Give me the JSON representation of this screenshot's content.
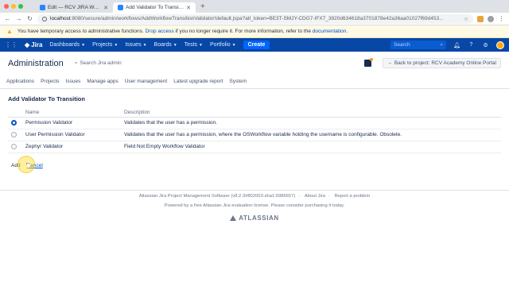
{
  "browser": {
    "tabs": [
      {
        "title": "Edit — RCV JIRA Workflow Tut",
        "active": false
      },
      {
        "title": "Add Validator To Transition - R",
        "active": true
      }
    ],
    "url_host": "localhost",
    "url_path": ":8080/secure/admin/workflows/AddWorkflowTransitionValidator!default.jspa?atl_token=BE3T-SMJY-CDG7-IFX7_3920d634618a3701878e42a36aa01027f69d453...",
    "new_tab_label": "+"
  },
  "banner": {
    "text_before": "You have temporary access to administrative functions.",
    "drop_link": "Drop access",
    "text_middle": "if you no longer require it. For more information, refer to the",
    "doc_link": "documentation",
    "text_after": "."
  },
  "nav": {
    "logo": "Jira",
    "items": [
      "Dashboards",
      "Projects",
      "Issues",
      "Boards",
      "Tests",
      "Portfolio"
    ],
    "create": "Create",
    "search_placeholder": "Search"
  },
  "admin": {
    "title": "Administration",
    "search": "Search Jira admin",
    "back_button": "Back to project: RCV Academy Online Portal",
    "tabs": [
      "Applications",
      "Projects",
      "Issues",
      "Manage apps",
      "User management",
      "Latest upgrade report",
      "System"
    ]
  },
  "page": {
    "heading": "Add Validator To Transition",
    "columns": {
      "name": "Name",
      "description": "Description"
    },
    "rows": [
      {
        "name": "Permission Validator",
        "description": "Validates that the user has a permission.",
        "selected": true
      },
      {
        "name": "User Permission Validator",
        "description": "Validates that the user has a permission, where the OSWorkflow variable holding the username is configurable. Obsolete.",
        "selected": false
      },
      {
        "name": "Zephyr Validator",
        "description": "Field Not Empty Workflow Validator",
        "selected": false
      }
    ],
    "add_button": "Add",
    "cancel_link": "Cancel"
  },
  "footer": {
    "software": "Atlassian Jira Project Management Software (v8.2.3#802003-sha1:5986657)",
    "about": "About Jira",
    "report": "Report a problem",
    "license": "Powered by a free Atlassian Jira evaluation license. Please consider purchasing it today.",
    "brand": "ATLASSIAN"
  },
  "colors": {
    "nav_bg": "#0747a6",
    "create_bg": "#0065ff",
    "banner_bg": "#fffae6",
    "link": "#0052cc"
  }
}
